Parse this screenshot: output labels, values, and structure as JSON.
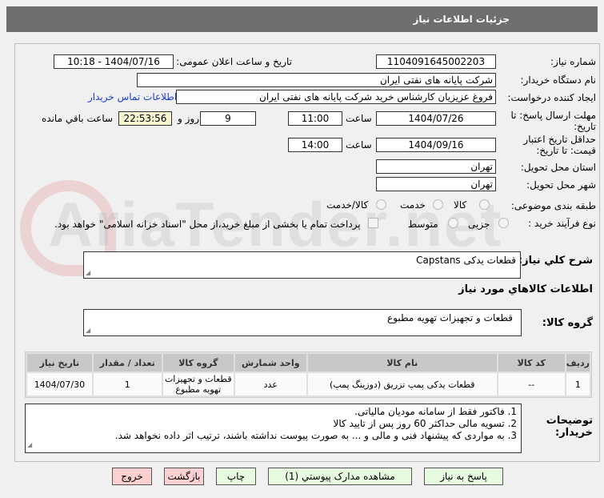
{
  "header": {
    "title": "جزئیات اطلاعات نیاز"
  },
  "watermark": "AriaTender.net",
  "form": {
    "need_number_label": "شماره نیاز:",
    "need_number": "1104091645002203",
    "announce_label": "تاریخ و ساعت اعلان عمومی:",
    "announce_value": "1404/07/16 - 10:18",
    "buyer_label": "نام دستگاه خریدار:",
    "buyer_value": "شرکت پایانه های نفتی ایران",
    "creator_label": "ایجاد کننده درخواست:",
    "creator_value": "فروغ  عزیزیان  کارشناس خرید شرکت پایانه های نفتی ایران",
    "contact_link": "اطلاعات تماس خریدار",
    "deadline_label": "مهلت ارسال پاسخ: تا تاریخ:",
    "deadline_date": "1404/07/26",
    "time_label": "ساعت",
    "deadline_time": "11:00",
    "days": "9",
    "days_label": "روز و",
    "remaining": "22:53:56",
    "remaining_label": "ساعت باقي مانده",
    "validity_label": "حداقل تاریخ اعتبار قیمت: تا تاریخ:",
    "validity_date": "1404/09/16",
    "validity_time": "14:00",
    "province_label": "استان محل تحویل:",
    "province": "تهران",
    "city_label": "شهر محل تحویل:",
    "city": "تهران",
    "category_label": "طبقه بندی موضوعی:",
    "category_options": [
      "کالا",
      "خدمت",
      "کالا/خدمت"
    ],
    "process_label": "نوع فرآیند خرید :",
    "process_options": [
      "جزیی",
      "متوسط"
    ],
    "payment_note": "پرداخت تمام یا بخشی از مبلغ خرید،از محل \"اسناد خزانه اسلامی\" خواهد بود.",
    "summary_label": "شرح کلي نیاز:",
    "summary": "قطعات یدکی Capstans",
    "goods_heading": "اطلاعات کالاهاي مورد نیاز",
    "group_label": "گروه کالا:",
    "group_value": "قطعات و تجهیزات تهویه مطبوع"
  },
  "table": {
    "headers": [
      "ردیف",
      "کد کالا",
      "نام کالا",
      "واحد شمارش",
      "گروه کالا",
      "تعداد / مقدار",
      "تاریخ نیاز"
    ],
    "rows": [
      [
        "1",
        "--",
        "قطعات یدکی پمپ تزریق (دوزینگ پمپ)",
        "عدد",
        "قطعات و تجهیزات تهویه مطبوع",
        "1",
        "1404/07/30"
      ]
    ]
  },
  "notes": {
    "label": "توضیحات خریدار:",
    "lines": [
      "1. فاکتور فقط از سامانه مودیان مالیاتی.",
      "2. تسویه مالی حداکثر 60 روز پس از تایید کالا",
      "3. به مواردی که پیشنهاد فنی و مالی و ... به صورت پیوست نداشته باشند، ترتیب اثر داده نخواهد شد."
    ]
  },
  "buttons": {
    "reply": "پاسخ به نیاز",
    "attachments": "مشاهده مدارک پیوستي (1)",
    "print": "چاپ",
    "back": "بازگشت",
    "exit": "خروج"
  }
}
